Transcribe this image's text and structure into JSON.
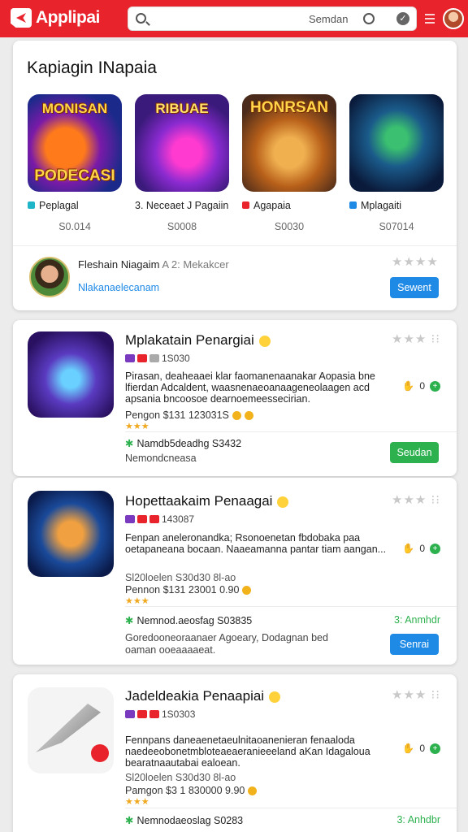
{
  "header": {
    "logo_text": "Applipai",
    "search_placeholder": "Semdan",
    "brand_color": "#e8232b"
  },
  "featured": {
    "title": "Kapiagin INapaia",
    "tiles": [
      {
        "art_text": "MONISAN",
        "art_text2": "PODECASI",
        "name": "Peplagal",
        "price": "S0.014",
        "icon_color": "#1fb5c9"
      },
      {
        "art_text": "RIBUAE",
        "name": "Neceaet J Pagaiin",
        "prefix": "3.",
        "price": "S0008",
        "icon_color": ""
      },
      {
        "art_text": "HONRSAN",
        "name": "Agapaia",
        "price": "S0030",
        "icon_color": "#e8232b"
      },
      {
        "art_text": "",
        "name": "Mplagaiti",
        "price": "S07014",
        "icon_color": "#1f8ae6"
      }
    ],
    "promo": {
      "title": "Fleshain Niagaim",
      "title_sub": "A 2: Mekakcer",
      "link": "Nlakanaelecanam",
      "button": "Sewent"
    }
  },
  "apps": [
    {
      "title": "Mplakatain Penargiai",
      "count": "1S030",
      "desc": "Pirasan, deaheaaei klar faomanenaanakar Aopasia bne lfierdan Adcaldent, waasnenaeoanaageneolaagen acd apsania bncoosoe dearnoemeessecirian.",
      "meta": "Pengon $131 123031S",
      "side_count": "0",
      "info": "Namdb5deadhg S3432",
      "note": "Nemondcneasa",
      "button": "Seudan"
    },
    {
      "title": "Hopettaakaim Penaagai",
      "count": "143087",
      "desc": "Fenpan aneleronandka; Rsonoenetan fbdobaka paa oetapaneana bocaan. Naaeamanna pantar tiam aangan...",
      "sub": "Sl20loelen S30d30 8l-ao",
      "meta": "Pennon $131 23001 0.90",
      "side_count": "0",
      "info": "Nemnod.aeosfag S03835",
      "side_link": "3: Anmhdr",
      "note": "Goredooneoraanaer Agoeary, Dodagnan bed oaman ooeaaaaeat.",
      "button": "Senrai"
    },
    {
      "title": "Jadeldeakia Penaapiai",
      "count": "1S0303",
      "desc": "Fennpans daneaenetaeulnitaoanenieran fenaaloda naedeeobonetmbloteaeaeranieeeland aKan Idagaloua bearatnaautabai ealoean.",
      "sub": "Sl20loelen S30d30 8l-ao",
      "meta": "Pamgon $3 1 830000 9.90",
      "side_count": "0",
      "info": "Nemnodaeoslag S0283",
      "side_link": "3: Anhdbr"
    }
  ]
}
